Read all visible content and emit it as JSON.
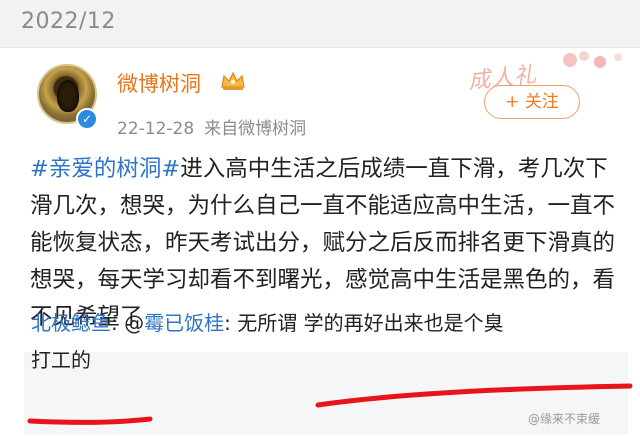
{
  "header": {
    "date": "2022/12"
  },
  "post": {
    "author": "微博树洞",
    "timestamp": "22-12-28",
    "source": "来自微博树洞",
    "follow_label": "+ 关注",
    "deco_text": "成人礼",
    "topic": "#亲爱的树洞#",
    "body": "进入高中生活之后成绩一直下滑，考几次下滑几次，想哭，为什么自己一直不能适应高中生活，一直不能恢复状态，昨天考试出分，赋分之后反而排名更下滑真的想哭，每天学习却看不到曙光，感觉高中生活是黑色的，看不见希望了"
  },
  "comment": {
    "author": "北极鲶鱼",
    "separator": ": @",
    "reply_to": "霉已饭桂",
    "colon": ": ",
    "text_part1": "无所谓 学的再好出来也是个臭",
    "text_part2": "打工的"
  },
  "watermark": "@缘来不束缓",
  "colors": {
    "accent_orange": "#f07b24",
    "link_blue": "#2e74c8",
    "underline_red": "#e8141c"
  }
}
